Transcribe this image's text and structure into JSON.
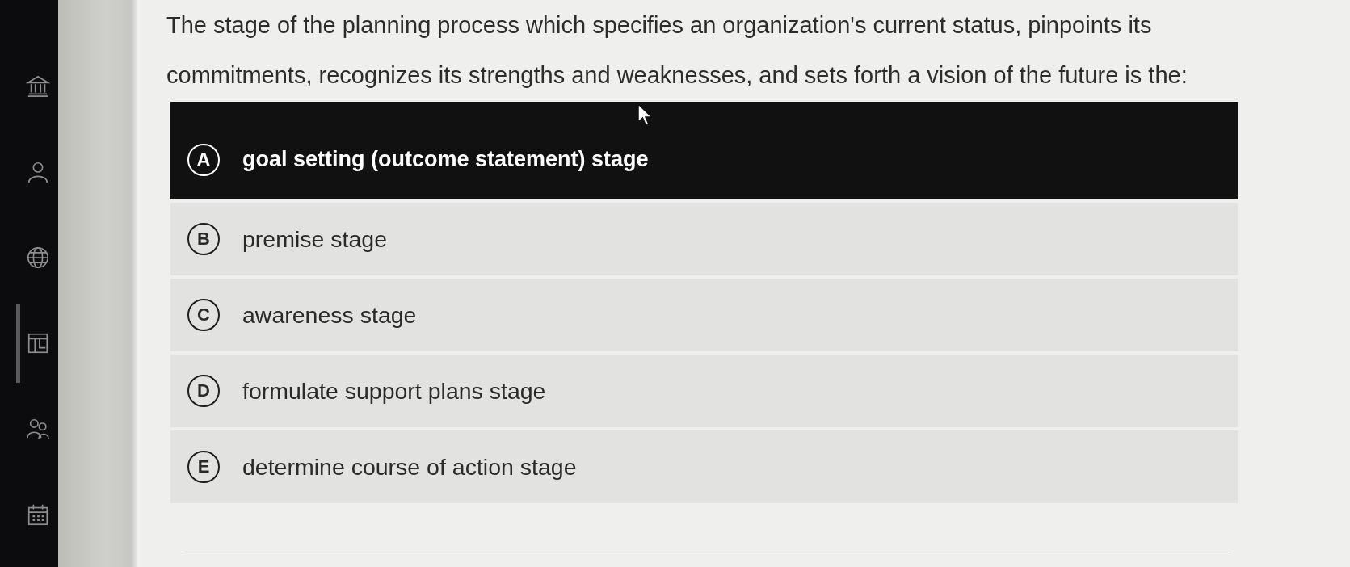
{
  "sidebar": {
    "items": [
      {
        "selected": false
      },
      {
        "selected": false
      },
      {
        "selected": false
      },
      {
        "selected": true
      },
      {
        "selected": false
      },
      {
        "selected": false
      }
    ]
  },
  "question": {
    "text": "The stage of the planning process which specifies an organization's current status, pinpoints its commitments, recognizes its strengths and weaknesses, and sets forth a vision of the future is the:"
  },
  "options": [
    {
      "letter": "A",
      "text": "goal setting (outcome statement) stage",
      "selected": true
    },
    {
      "letter": "B",
      "text": "premise stage",
      "selected": false
    },
    {
      "letter": "C",
      "text": "awareness stage",
      "selected": false
    },
    {
      "letter": "D",
      "text": "formulate support plans stage",
      "selected": false
    },
    {
      "letter": "E",
      "text": "determine course of action stage",
      "selected": false
    }
  ]
}
